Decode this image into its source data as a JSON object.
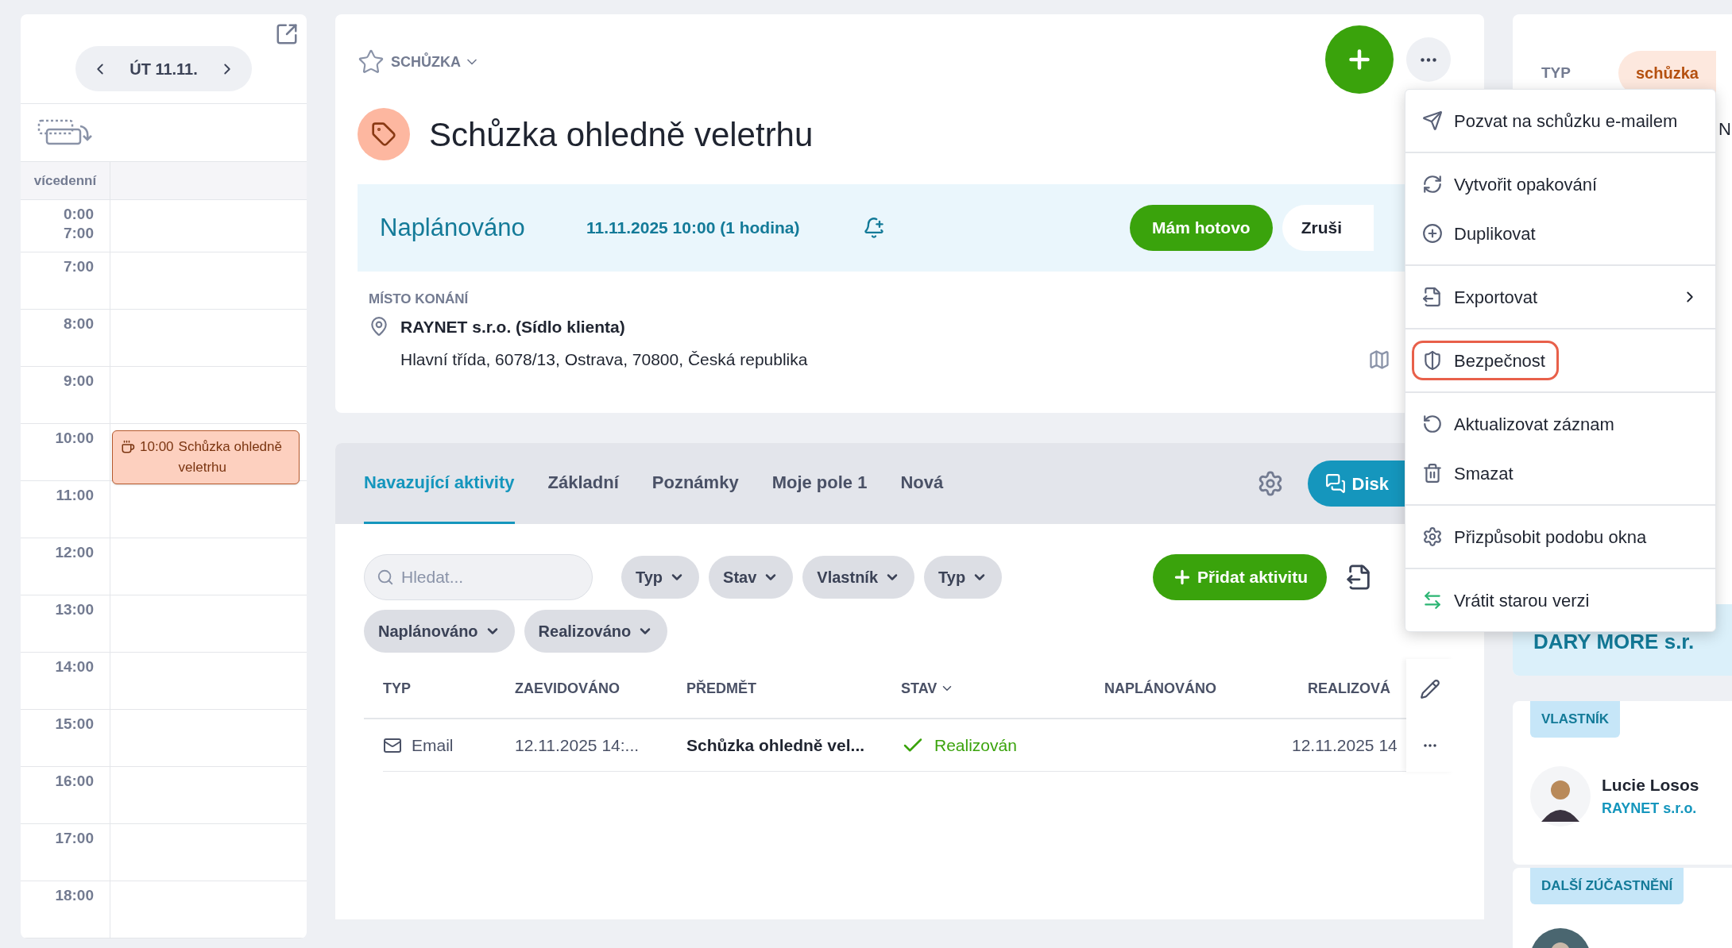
{
  "calendar": {
    "date": "ÚT 11.11.",
    "all_day_label": "vícedenní",
    "rows": [
      {
        "labels": [
          "0:00",
          "7:00"
        ],
        "events": []
      },
      {
        "labels": [
          "7:00"
        ],
        "events": []
      },
      {
        "labels": [
          "8:00"
        ],
        "events": []
      },
      {
        "labels": [
          "9:00"
        ],
        "events": []
      },
      {
        "labels": [
          "10:00"
        ],
        "events": [
          {
            "time": "10:00",
            "title": "Schůzka ohledně veletrhu"
          }
        ]
      },
      {
        "labels": [
          "11:00"
        ],
        "events": []
      },
      {
        "labels": [
          "12:00"
        ],
        "events": []
      },
      {
        "labels": [
          "13:00"
        ],
        "events": []
      },
      {
        "labels": [
          "14:00"
        ],
        "events": []
      },
      {
        "labels": [
          "15:00"
        ],
        "events": []
      },
      {
        "labels": [
          "16:00"
        ],
        "events": []
      },
      {
        "labels": [
          "17:00"
        ],
        "events": []
      },
      {
        "labels": [
          "18:00"
        ],
        "events": []
      }
    ]
  },
  "record": {
    "type": "SCHŮZKA",
    "favorite": false,
    "title": "Schůzka ohledně veletrhu",
    "status": "Naplánováno",
    "when": "11.11.2025 10:00 (1 hodina)",
    "primary_action": "Mám hotovo",
    "secondary_action": "Zruši",
    "location_label": "MÍSTO KONÁNÍ",
    "location_name": "RAYNET s.r.o. (Sídlo klienta)",
    "address": "Hlavní třída, 6078/13, Ostrava, 70800, Česká republika"
  },
  "activities": {
    "tabs": [
      {
        "label": "Navazující aktivity",
        "selected": true
      },
      {
        "label": "Základní",
        "selected": false
      },
      {
        "label": "Poznámky",
        "selected": false
      },
      {
        "label": "Moje pole 1",
        "selected": false
      },
      {
        "label": "Nová",
        "selected": false
      }
    ],
    "discuss_button": "Disk",
    "search": {
      "placeholder": "Hledat..."
    },
    "filter_rows": [
      [
        "Typ",
        "Stav",
        "Vlastník",
        "Typ"
      ],
      [
        "Naplánováno",
        "Realizováno"
      ]
    ],
    "add_button": "Přidat aktivitu",
    "columns": [
      {
        "label": "TYP",
        "sortable": false
      },
      {
        "label": "ZAEVIDOVÁNO",
        "sortable": false
      },
      {
        "label": "PŘEDMĚT",
        "sortable": false
      },
      {
        "label": "STAV",
        "sortable": true
      },
      {
        "label": "NAPLÁNOVÁNO",
        "sortable": false
      },
      {
        "label": "REALIZOVÁ",
        "sortable": false
      }
    ],
    "rows": [
      {
        "kind": "email",
        "type": "Email",
        "created": "12.11.2025 14:...",
        "subject": "Schůzka ohledně vel...",
        "status": {
          "label": "Realizován",
          "done": true
        },
        "realized": "12.11.2025 14"
      }
    ]
  },
  "menu": {
    "sections": [
      [
        {
          "label": "Pozvat na schůzku e-mailem",
          "submenu": false,
          "highlighted": false
        }
      ],
      [
        {
          "label": "Vytvořit opakování",
          "submenu": false,
          "highlighted": false
        },
        {
          "label": "Duplikovat",
          "submenu": false,
          "highlighted": false
        }
      ],
      [
        {
          "label": "Exportovat",
          "submenu": true,
          "highlighted": false
        }
      ],
      [
        {
          "label": "Bezpečnost",
          "submenu": false,
          "highlighted": true
        }
      ],
      [
        {
          "label": "Aktualizovat záznam",
          "submenu": false,
          "highlighted": false
        },
        {
          "label": "Smazat",
          "submenu": false,
          "highlighted": false
        }
      ],
      [
        {
          "label": "Přizpůsobit podobu okna",
          "submenu": false,
          "highlighted": false
        }
      ],
      [
        {
          "label": "Vrátit starou verzi",
          "submenu": false,
          "highlighted": false
        }
      ]
    ]
  },
  "side": {
    "type_label": "TYP",
    "type_value": "schůzka",
    "cut_text": "N",
    "company": "DARY MORE s.r.",
    "owner_label": "VLASTNÍK",
    "owner_name": "Lucie Losos",
    "owner_company": "RAYNET s.r.o.",
    "participants_label": "DALŠÍ ZÚČASTNĚNÍ"
  }
}
